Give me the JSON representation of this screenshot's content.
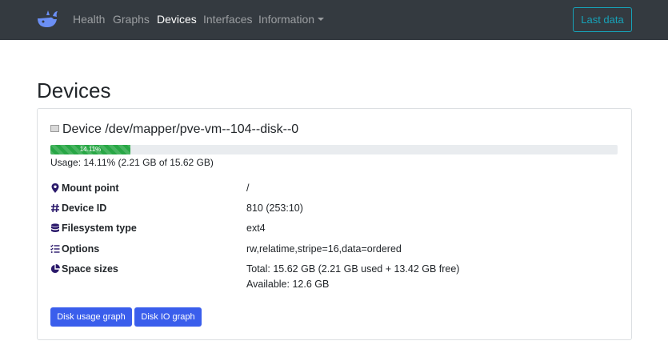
{
  "nav": {
    "items": [
      {
        "label": "Health"
      },
      {
        "label": "Graphs"
      },
      {
        "label": "Devices"
      },
      {
        "label": "Interfaces"
      },
      {
        "label": "Information"
      }
    ],
    "last_data_label": "Last data"
  },
  "page": {
    "title": "Devices"
  },
  "device": {
    "title": "Device /dev/mapper/pve-vm--104--disk--0",
    "usage_percent": 14.11,
    "progress_label": "14.11%",
    "usage_text": "Usage: 14.11% (2.21 GB of 15.62 GB)",
    "rows": [
      {
        "icon": "map-marker-icon",
        "label": "Mount point",
        "value": "/"
      },
      {
        "icon": "hashtag-icon",
        "label": "Device ID",
        "value": "810 (253:10)"
      },
      {
        "icon": "database-icon",
        "label": "Filesystem type",
        "value": "ext4"
      },
      {
        "icon": "list-check-icon",
        "label": "Options",
        "value": "rw,relatime,stripe=16,data=ordered"
      },
      {
        "icon": "pie-chart-icon",
        "label": "Space sizes",
        "value": "Total: 15.62 GB (2.21 GB used + 13.42 GB free)",
        "value2": "Available: 12.6 GB"
      }
    ],
    "buttons": {
      "disk_usage": "Disk usage graph",
      "disk_io": "Disk IO graph"
    }
  },
  "colors": {
    "navbar": "#343a40",
    "accent": "#17a2b8",
    "primary": "#3a5eec",
    "progress": "#28a745",
    "icon": "#2b1a6b"
  }
}
